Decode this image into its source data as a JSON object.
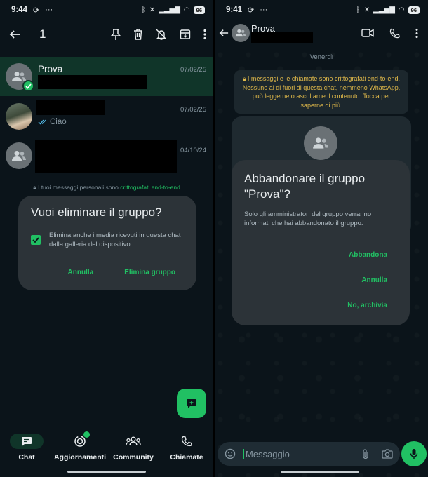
{
  "left": {
    "status": {
      "time": "9:44",
      "battery": "96"
    },
    "selection": {
      "count": "1"
    },
    "chats": [
      {
        "name": "Prova",
        "date": "07/02/25",
        "selected": true
      },
      {
        "name": "",
        "date": "07/02/25",
        "preview": "Ciao"
      },
      {
        "name": "",
        "date": "04/10/24"
      }
    ],
    "e2e_notice": {
      "text": "I tuoi messaggi personali sono ",
      "highlight": "crittografati end-to-end"
    },
    "dialog": {
      "title": "Vuoi eliminare il gruppo?",
      "option": "Elimina anche i media ricevuti in questa chat dalla galleria del dispositivo",
      "option_checked": true,
      "cancel": "Annulla",
      "confirm": "Elimina gruppo"
    },
    "nav": {
      "chat": "Chat",
      "updates": "Aggiornamenti",
      "community": "Community",
      "calls": "Chiamate"
    }
  },
  "right": {
    "status": {
      "time": "9:41",
      "battery": "96"
    },
    "header": {
      "name": "Prova"
    },
    "day": "Venerdì",
    "system_message": "I messaggi e le chiamate sono crittografati end-to-end. Nessuno al di fuori di questa chat, nemmeno WhatsApp, può leggerne o ascoltarne il contenuto. Tocca per saperne di più.",
    "dialog": {
      "title": "Abbandonare il gruppo \"Prova\"?",
      "body": "Solo gli amministratori del gruppo verranno informati che hai abbandonato il gruppo.",
      "leave": "Abbandona",
      "cancel": "Annulla",
      "archive": "No, archivia"
    },
    "composer": {
      "placeholder": "Messaggio"
    }
  },
  "colors": {
    "accent": "#21c063",
    "background": "#0b141a",
    "dialog": "#2c3338",
    "selected_row": "#103529"
  }
}
